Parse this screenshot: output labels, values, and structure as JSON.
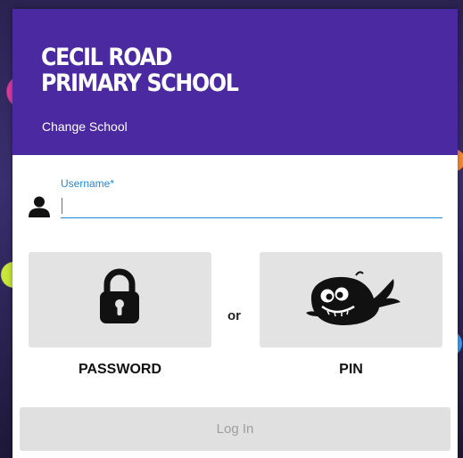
{
  "school": {
    "name": "CECIL ROAD\nPRIMARY SCHOOL",
    "change_link": "Change School"
  },
  "login": {
    "username_label": "Username*",
    "username_value": "",
    "or_text": "or",
    "password_label": "PASSWORD",
    "pin_label": "PIN",
    "submit_label": "Log In"
  },
  "icons": {
    "user": "user-icon",
    "password": "padlock-icon",
    "pin": "whale-icon"
  },
  "colors": {
    "header": "#4b29a0",
    "accent": "#1f88d9",
    "tile": "#e3e3e3",
    "button_disabled": "#e0e0e0"
  }
}
